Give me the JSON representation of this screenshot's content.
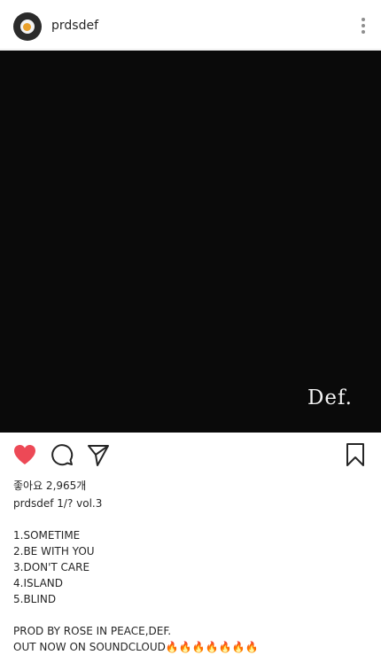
{
  "header": {
    "username": "prdsdef"
  },
  "post": {
    "watermark_text": "Def."
  },
  "actions": {
    "like_color": "#ed4956"
  },
  "likes_text": "좋아요 2,965개",
  "caption": {
    "username": "prdsdef",
    "title": "1/? vol.3",
    "tracks": [
      "1.SOMETIME",
      "2.BE WITH YOU",
      "3.DON'T CARE",
      "4.ISLAND",
      "5.BLIND"
    ],
    "prod_line": "PROD BY ROSE IN PEACE,DEF.",
    "out_line": "OUT NOW ON SOUNDCLOUD",
    "emoji": "🔥🔥🔥🔥🔥🔥🔥"
  }
}
